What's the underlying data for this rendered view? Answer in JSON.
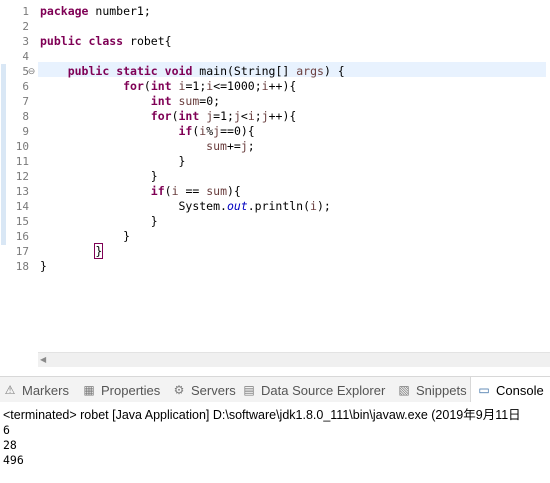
{
  "editor": {
    "line_numbers": [
      "1",
      "2",
      "3",
      "4",
      "5",
      "6",
      "7",
      "8",
      "9",
      "10",
      "11",
      "12",
      "13",
      "14",
      "15",
      "16",
      "17",
      "18"
    ],
    "fold_icon": "collapse-icon",
    "lines": [
      [
        {
          "t": "package",
          "c": "kw"
        },
        {
          "t": " number1;"
        }
      ],
      [],
      [
        {
          "t": "public",
          "c": "kw"
        },
        {
          "t": " "
        },
        {
          "t": "class",
          "c": "kw"
        },
        {
          "t": " robet{"
        }
      ],
      [],
      [
        {
          "t": "    "
        },
        {
          "t": "public",
          "c": "kw"
        },
        {
          "t": " "
        },
        {
          "t": "static",
          "c": "kw"
        },
        {
          "t": " "
        },
        {
          "t": "void",
          "c": "kw"
        },
        {
          "t": " main(String[] "
        },
        {
          "t": "args",
          "c": "var"
        },
        {
          "t": ") {"
        }
      ],
      [
        {
          "t": "            "
        },
        {
          "t": "for",
          "c": "kw"
        },
        {
          "t": "("
        },
        {
          "t": "int",
          "c": "kw"
        },
        {
          "t": " "
        },
        {
          "t": "i",
          "c": "var"
        },
        {
          "t": "=1;"
        },
        {
          "t": "i",
          "c": "var"
        },
        {
          "t": "<=1000;"
        },
        {
          "t": "i",
          "c": "var"
        },
        {
          "t": "++){"
        }
      ],
      [
        {
          "t": "                "
        },
        {
          "t": "int",
          "c": "kw"
        },
        {
          "t": " "
        },
        {
          "t": "sum",
          "c": "var"
        },
        {
          "t": "=0;"
        }
      ],
      [
        {
          "t": "                "
        },
        {
          "t": "for",
          "c": "kw"
        },
        {
          "t": "("
        },
        {
          "t": "int",
          "c": "kw"
        },
        {
          "t": " "
        },
        {
          "t": "j",
          "c": "var"
        },
        {
          "t": "=1;"
        },
        {
          "t": "j",
          "c": "var"
        },
        {
          "t": "<"
        },
        {
          "t": "i",
          "c": "var"
        },
        {
          "t": ";"
        },
        {
          "t": "j",
          "c": "var"
        },
        {
          "t": "++){"
        }
      ],
      [
        {
          "t": "                    "
        },
        {
          "t": "if",
          "c": "kw"
        },
        {
          "t": "("
        },
        {
          "t": "i",
          "c": "var"
        },
        {
          "t": "%"
        },
        {
          "t": "j",
          "c": "var"
        },
        {
          "t": "==0){"
        }
      ],
      [
        {
          "t": "                        "
        },
        {
          "t": "sum",
          "c": "var"
        },
        {
          "t": "+="
        },
        {
          "t": "j",
          "c": "var"
        },
        {
          "t": ";"
        }
      ],
      [
        {
          "t": "                    }"
        }
      ],
      [
        {
          "t": "                }"
        }
      ],
      [
        {
          "t": "                "
        },
        {
          "t": "if",
          "c": "kw"
        },
        {
          "t": "("
        },
        {
          "t": "i",
          "c": "var"
        },
        {
          "t": " == "
        },
        {
          "t": "sum",
          "c": "var"
        },
        {
          "t": "){"
        }
      ],
      [
        {
          "t": "                    System."
        },
        {
          "t": "out",
          "c": "field"
        },
        {
          "t": ".println("
        },
        {
          "t": "i",
          "c": "var"
        },
        {
          "t": ");"
        }
      ],
      [
        {
          "t": "                }"
        }
      ],
      [
        {
          "t": "            }"
        }
      ],
      [
        {
          "t": "        "
        },
        {
          "t": "}",
          "c": "caret"
        }
      ],
      [
        {
          "t": "}"
        }
      ]
    ]
  },
  "bottom_tabs": [
    {
      "label": "Markers",
      "icon": "markers-icon",
      "glyph": "⚠"
    },
    {
      "label": "Properties",
      "icon": "properties-icon",
      "glyph": "▦"
    },
    {
      "label": "Servers",
      "icon": "servers-icon",
      "glyph": "⚙"
    },
    {
      "label": "Data Source Explorer",
      "icon": "data-source-icon",
      "glyph": "▤"
    },
    {
      "label": "Snippets",
      "icon": "snippets-icon",
      "glyph": "▧"
    },
    {
      "label": "Console",
      "icon": "console-icon",
      "glyph": "▭",
      "active": true
    }
  ],
  "console": {
    "status": "<terminated> robet [Java Application] D:\\software\\jdk1.8.0_111\\bin\\javaw.exe (2019年9月11日",
    "output": [
      "6",
      "28",
      "496"
    ]
  }
}
